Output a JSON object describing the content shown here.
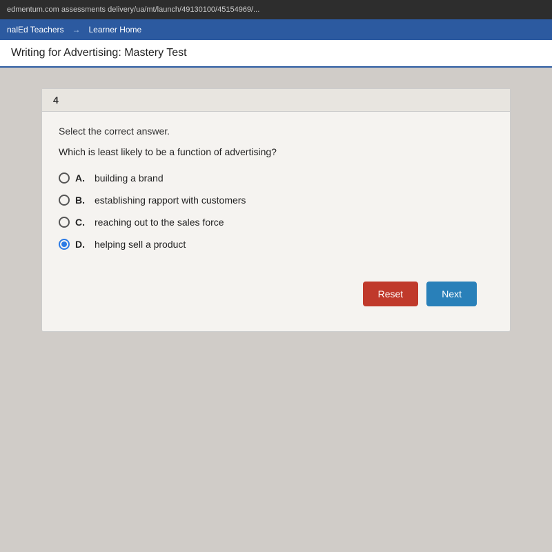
{
  "browser": {
    "url": "edmentum.com assessments delivery/ua/mt/launch/49130100/45154969/..."
  },
  "navbar": {
    "link1": "nalEd Teachers",
    "separator": "→",
    "link2": "Learner Home"
  },
  "page": {
    "title": "Writing for Advertising: Mastery Test"
  },
  "question": {
    "number": "4",
    "instruction": "Select the correct answer.",
    "text": "Which is least likely to be a function of advertising?",
    "options": [
      {
        "letter": "A.",
        "text": "building a brand",
        "selected": false
      },
      {
        "letter": "B.",
        "text": "establishing rapport with customers",
        "selected": false
      },
      {
        "letter": "C.",
        "text": "reaching out to the sales force",
        "selected": false
      },
      {
        "letter": "D.",
        "text": "helping sell a product",
        "selected": true
      }
    ]
  },
  "buttons": {
    "reset": "Reset",
    "next": "Next"
  }
}
